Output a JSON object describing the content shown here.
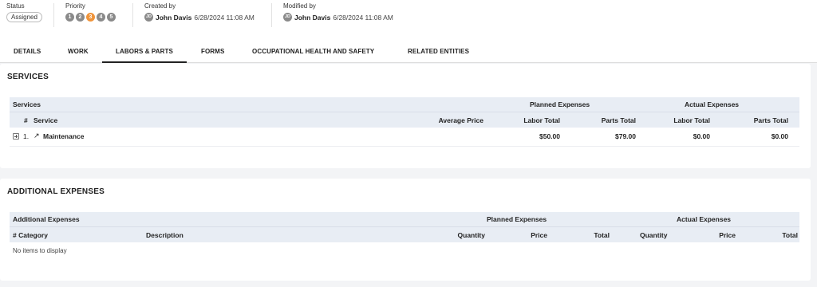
{
  "header": {
    "status_label": "Status",
    "status_value": "Assigned",
    "priority_label": "Priority",
    "priority_levels": [
      "1",
      "2",
      "3",
      "4",
      "5"
    ],
    "priority_active": "3",
    "created_label": "Created by",
    "created_initials": "JD",
    "created_name": "John Davis",
    "created_date": "6/28/2024 11:08 AM",
    "modified_label": "Modified by",
    "modified_initials": "JD",
    "modified_name": "John Davis",
    "modified_date": "6/28/2024 11:08 AM",
    "accent_color": "#f0943a"
  },
  "tabs": [
    {
      "label": "DETAILS"
    },
    {
      "label": "WORK"
    },
    {
      "label": "LABORS & PARTS",
      "active": true
    },
    {
      "label": "FORMS"
    },
    {
      "label": "OCCUPATIONAL HEALTH AND SAFETY"
    },
    {
      "label": "RELATED ENTITIES"
    }
  ],
  "services": {
    "title": "SERVICES",
    "group_label": "Services",
    "planned_label": "Planned Expenses",
    "actual_label": "Actual Expenses",
    "columns": {
      "num": "#",
      "service": "Service",
      "avg_price": "Average Price",
      "labor_total": "Labor Total",
      "parts_total": "Parts Total",
      "actual_labor_total": "Labor Total",
      "actual_parts_total": "Parts Total"
    },
    "rows": [
      {
        "num": "1.",
        "name": "Maintenance",
        "avg_price": "",
        "planned_labor": "$50.00",
        "planned_parts": "$79.00",
        "actual_labor": "$0.00",
        "actual_parts": "$0.00"
      }
    ]
  },
  "additional": {
    "title": "ADDITIONAL EXPENSES",
    "group_label": "Additional Expenses",
    "planned_label": "Planned Expenses",
    "actual_label": "Actual Expenses",
    "columns": {
      "num_category": "# Category",
      "description": "Description",
      "quantity": "Quantity",
      "price": "Price",
      "total": "Total",
      "actual_quantity": "Quantity",
      "actual_price": "Price",
      "actual_total": "Total"
    },
    "empty_text": "No items to display"
  }
}
